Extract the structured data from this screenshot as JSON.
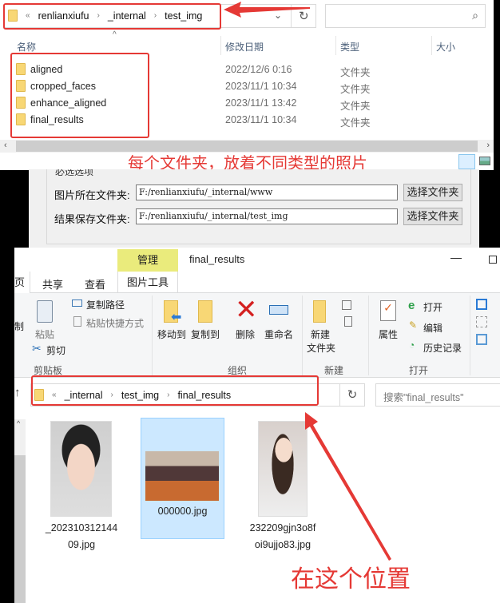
{
  "top_explorer": {
    "breadcrumb": {
      "overflow": "«",
      "items": [
        "renlianxiufu",
        "_internal",
        "test_img"
      ]
    },
    "search_placeholder": "",
    "columns": [
      "名称",
      "修改日期",
      "类型",
      "大小"
    ],
    "rows": [
      {
        "name": "aligned",
        "date": "2022/12/6 0:16",
        "type": "文件夹"
      },
      {
        "name": "cropped_faces",
        "date": "2023/11/1 10:34",
        "type": "文件夹"
      },
      {
        "name": "enhance_aligned",
        "date": "2023/11/1 13:42",
        "type": "文件夹"
      },
      {
        "name": "final_results",
        "date": "2023/11/1 10:34",
        "type": "文件夹"
      }
    ],
    "annotation": "每个文件夹，放着不同类型的照片"
  },
  "dialog": {
    "group_title": "必选选项",
    "rows": [
      {
        "label": "图片所在文件夹:",
        "value": "F:/renlianxiufu/_internal/www",
        "button": "选择文件夹"
      },
      {
        "label": "结果保存文件夹:",
        "value": "F:/renlianxiufu/_internal/test_img",
        "button": "选择文件夹"
      }
    ]
  },
  "bottom_explorer": {
    "context_tab": "管理",
    "window_title": "final_results",
    "tabs": [
      "页",
      "共享",
      "查看",
      "图片工具"
    ],
    "ribbon": {
      "clipboard": {
        "copy": "制",
        "paste": "粘贴",
        "copy_path": "复制路径",
        "paste_shortcut": "粘贴快捷方式",
        "cut": "剪切",
        "group": "剪贴板"
      },
      "organize": {
        "move_to": "移动到",
        "copy_to": "复制到",
        "delete": "删除",
        "rename": "重命名",
        "group": "组织"
      },
      "new": {
        "new_folder_1": "新建",
        "new_folder_2": "文件夹",
        "group": "新建"
      },
      "open": {
        "properties": "属性",
        "open": "打开",
        "edit": "编辑",
        "history": "历史记录",
        "group": "打开"
      }
    },
    "breadcrumb": {
      "overflow": "«",
      "items": [
        "_internal",
        "test_img",
        "final_results"
      ]
    },
    "search_placeholder": "搜索\"final_results\"",
    "files": [
      {
        "line1": "_202310312144",
        "line2": "09.jpg"
      },
      {
        "line1": "000000.jpg",
        "line2": ""
      },
      {
        "line1": "232209gjn3o8f",
        "line2": "oi9ujjo83.jpg"
      }
    ],
    "annotation": "在这个位置"
  },
  "colors": {
    "annotation": "#e53935",
    "selection": "#cce8ff",
    "context_tab": "#eaeb7c"
  }
}
